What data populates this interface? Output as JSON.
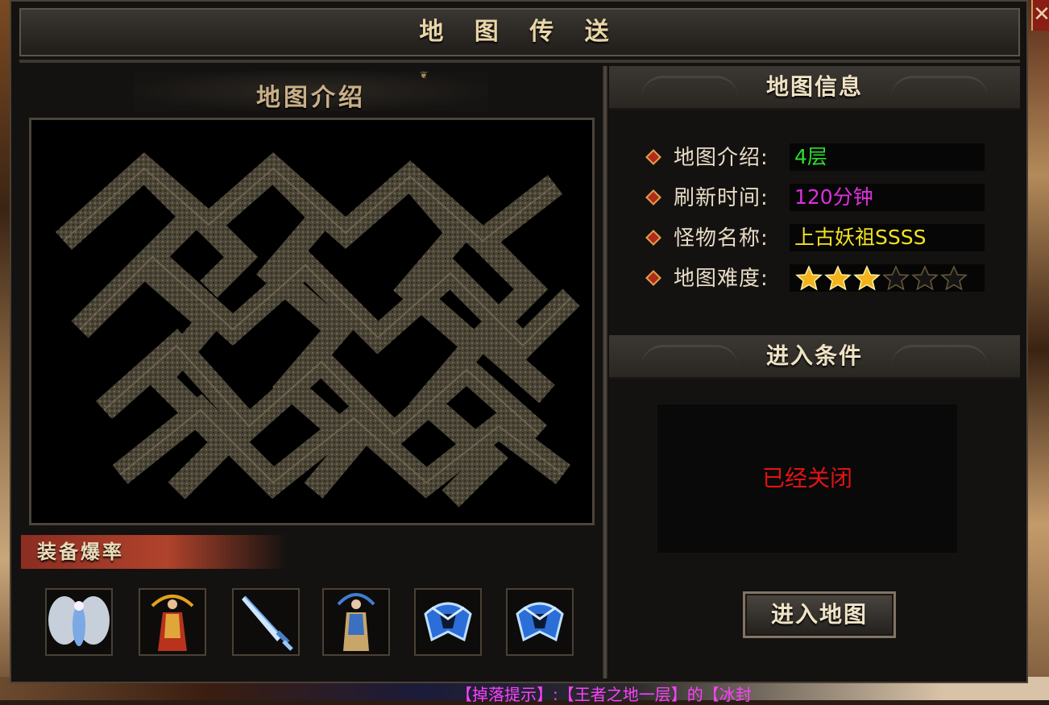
{
  "window": {
    "title": "地 图 传 送",
    "close_icon": "close-icon"
  },
  "left": {
    "map_intro_header": "地图介绍",
    "map_image": "maze-map-image",
    "drops_header": "装备爆率",
    "drops": [
      {
        "icon": "white-wings-armor-icon"
      },
      {
        "icon": "golden-goddess-armor-icon"
      },
      {
        "icon": "ice-sword-icon"
      },
      {
        "icon": "blue-goddess-armor-icon"
      },
      {
        "icon": "blue-helmet-icon"
      },
      {
        "icon": "blue-helmet-icon"
      }
    ]
  },
  "right": {
    "info_header": "地图信息",
    "rows": [
      {
        "label": "地图介绍:",
        "value": "4层",
        "color": "#2fdc2f"
      },
      {
        "label": "刷新时间:",
        "value": "120分钟",
        "color": "#e02ee0"
      },
      {
        "label": "怪物名称:",
        "value": "上古妖祖SSSS",
        "color": "#f3e31f"
      },
      {
        "label": "地图难度:",
        "stars_filled": 3,
        "stars_total": 6
      }
    ],
    "conditions_header": "进入条件",
    "conditions_text": "已经关闭",
    "enter_button": "进入地图"
  },
  "background": {
    "chat_text": "【掉落提示】:【王者之地一层】的【冰封"
  },
  "colors": {
    "accent_gold": "#e9d6a8",
    "closed_red": "#e21313",
    "star_gold": "#f2b41a"
  }
}
